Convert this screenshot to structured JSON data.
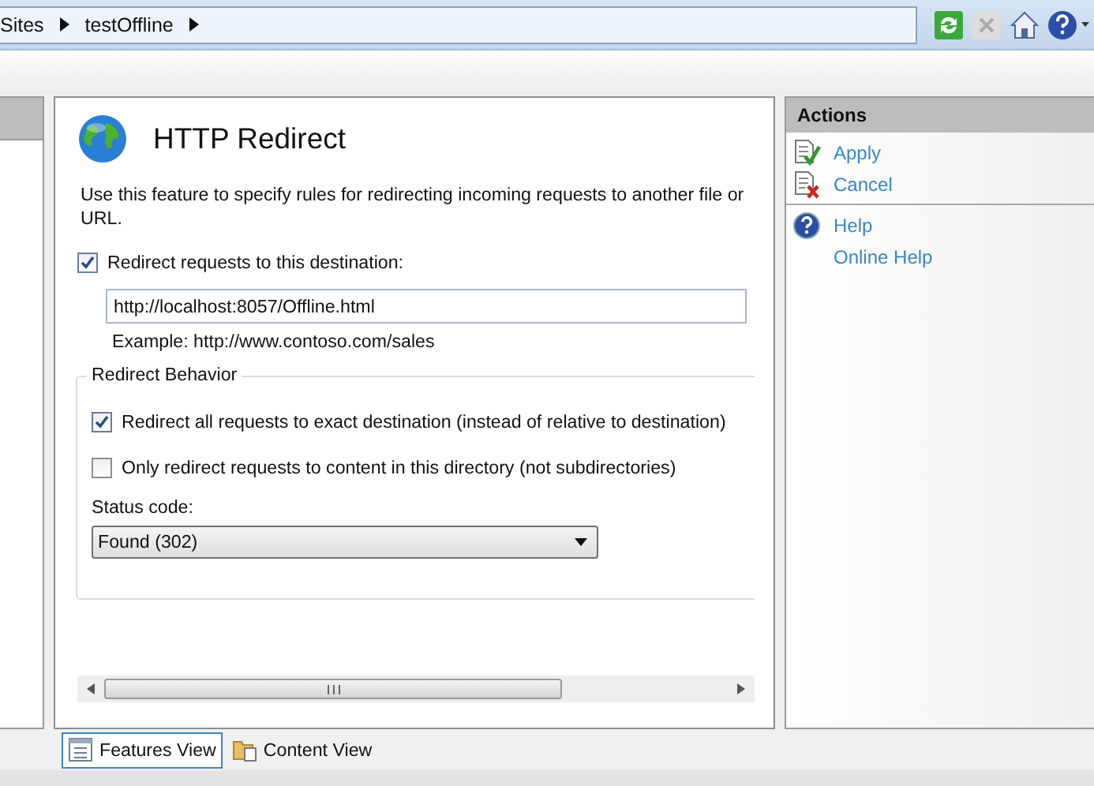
{
  "address_bar": {
    "breadcrumbs": [
      {
        "label": "Sites"
      },
      {
        "label": "testOffline"
      }
    ]
  },
  "feature": {
    "title": "HTTP Redirect",
    "description": "Use this feature to specify rules for redirecting incoming requests to another file or URL.",
    "redirect": {
      "label": "Redirect requests to this destination:",
      "checked": true
    },
    "destination": {
      "value": "http://localhost:8057/Offline.html"
    },
    "example": "Example: http://www.contoso.com/sales",
    "behavior": {
      "legend": "Redirect Behavior",
      "options": [
        {
          "label": "Redirect all requests to exact destination (instead of relative to destination)",
          "checked": true
        },
        {
          "label": "Only redirect requests to content in this directory (not subdirectories)",
          "checked": false
        }
      ],
      "status_label": "Status code:",
      "status_value": "Found (302)"
    }
  },
  "actions": {
    "title": "Actions",
    "groups": [
      {
        "items": [
          {
            "label": "Apply",
            "kind": "apply"
          },
          {
            "label": "Cancel",
            "kind": "cancel"
          }
        ]
      },
      {
        "items": [
          {
            "label": "Help",
            "kind": "help"
          },
          {
            "label": "Online Help",
            "kind": "plain"
          }
        ]
      }
    ]
  },
  "view_tabs": [
    {
      "label": "Features View",
      "kind": "features",
      "selected": true
    },
    {
      "label": "Content View",
      "kind": "content",
      "selected": false
    }
  ]
}
